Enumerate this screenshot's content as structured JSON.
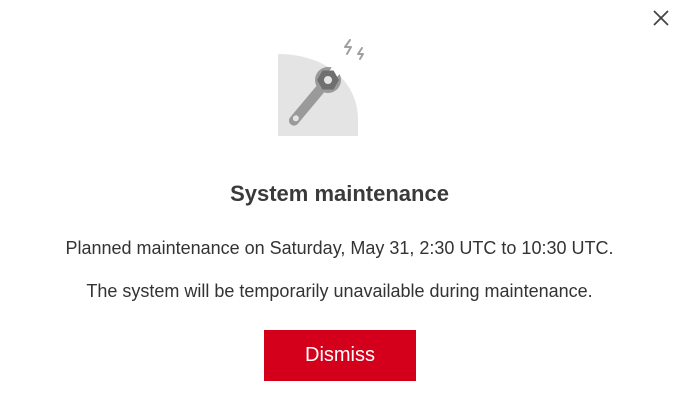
{
  "dialog": {
    "title": "System maintenance",
    "message_line1": "Planned maintenance on Saturday, May 31, 2:30 UTC to 10:30 UTC.",
    "message_line2": "The system will be temporarily unavailable during maintenance.",
    "dismiss_label": "Dismiss",
    "close_icon": "close-icon",
    "illustration_icon": "wrench-maintenance-icon"
  },
  "colors": {
    "accent": "#d4001b",
    "title_text": "#3a3a3a",
    "body_text": "#333333",
    "illustration_gray": "#c8c8c8"
  }
}
